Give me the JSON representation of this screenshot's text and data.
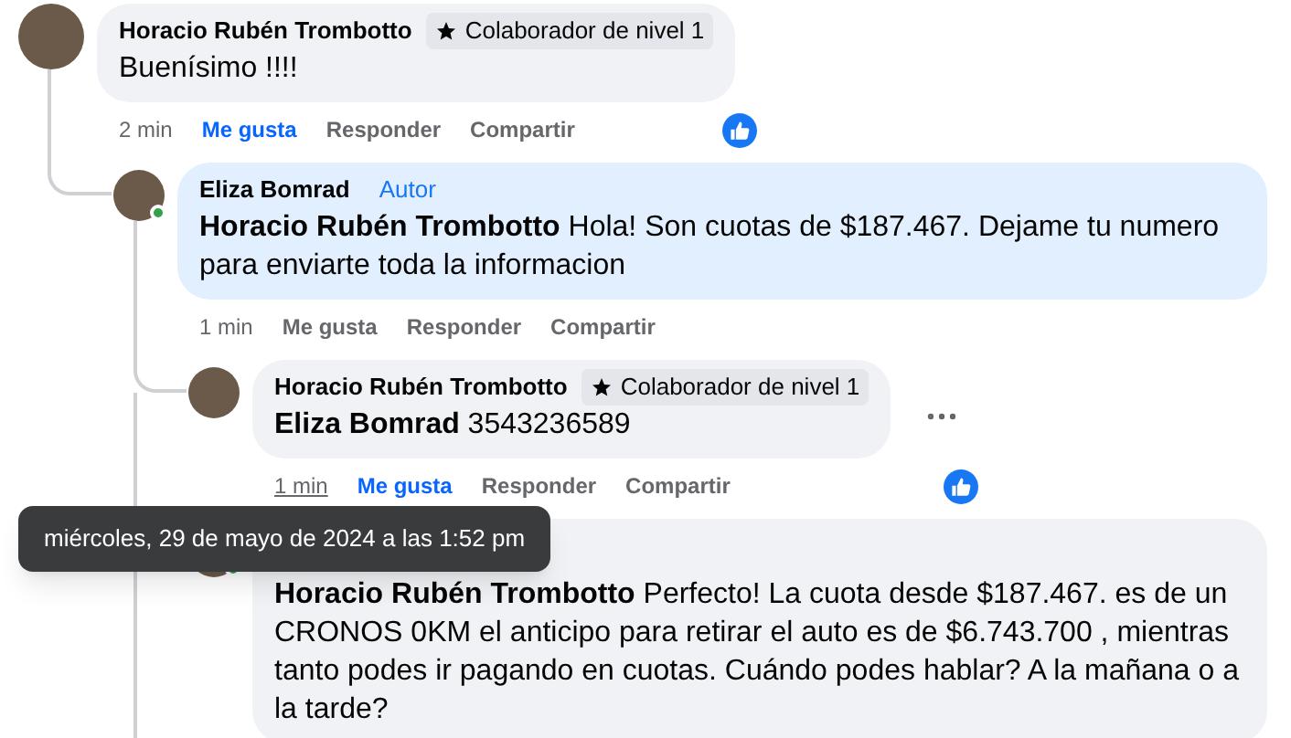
{
  "comments": [
    {
      "author": "Horacio Rubén Trombotto",
      "badge": "Colaborador de nivel 1",
      "text": "Buenísimo !!!!",
      "time": "2 min",
      "time_hovered": false,
      "like": "Me gusta",
      "liked": true,
      "reply": "Responder",
      "share": "Compartir",
      "has_reaction": true,
      "children": [
        {
          "author": "Eliza Bomrad",
          "author_tag": "Autor",
          "text": "**Horacio Rubén Trombotto** Hola! Son cuotas de $187.467. Dejame tu numero para enviarte toda la informacion",
          "highlighted": true,
          "online": true,
          "time": "1 min",
          "time_hovered": false,
          "like": "Me gusta",
          "liked": false,
          "reply": "Responder",
          "share": "Compartir",
          "children": [
            {
              "author": "Horacio Rubén Trombotto",
              "badge": "Colaborador de nivel 1",
              "text": "**Eliza Bomrad** 3543236589",
              "time": "1 min",
              "time_hovered": true,
              "like": "Me gusta",
              "liked": true,
              "reply": "Responder",
              "share": "Compartir",
              "has_reaction": true,
              "more_menu": true
            },
            {
              "text": "**Horacio Rubén Trombotto** Perfecto! La cuota desde $187.467. es de un CRONOS 0KM el anticipo para retirar el auto es de $6.743.700 , mientras tanto podes ir pagando en cuotas. Cuándo podes hablar? A la mañana o a la tarde?",
              "online": true
            }
          ]
        }
      ]
    }
  ],
  "tooltip": {
    "text": "miércoles, 29 de mayo de 2024 a las 1:52 pm"
  }
}
